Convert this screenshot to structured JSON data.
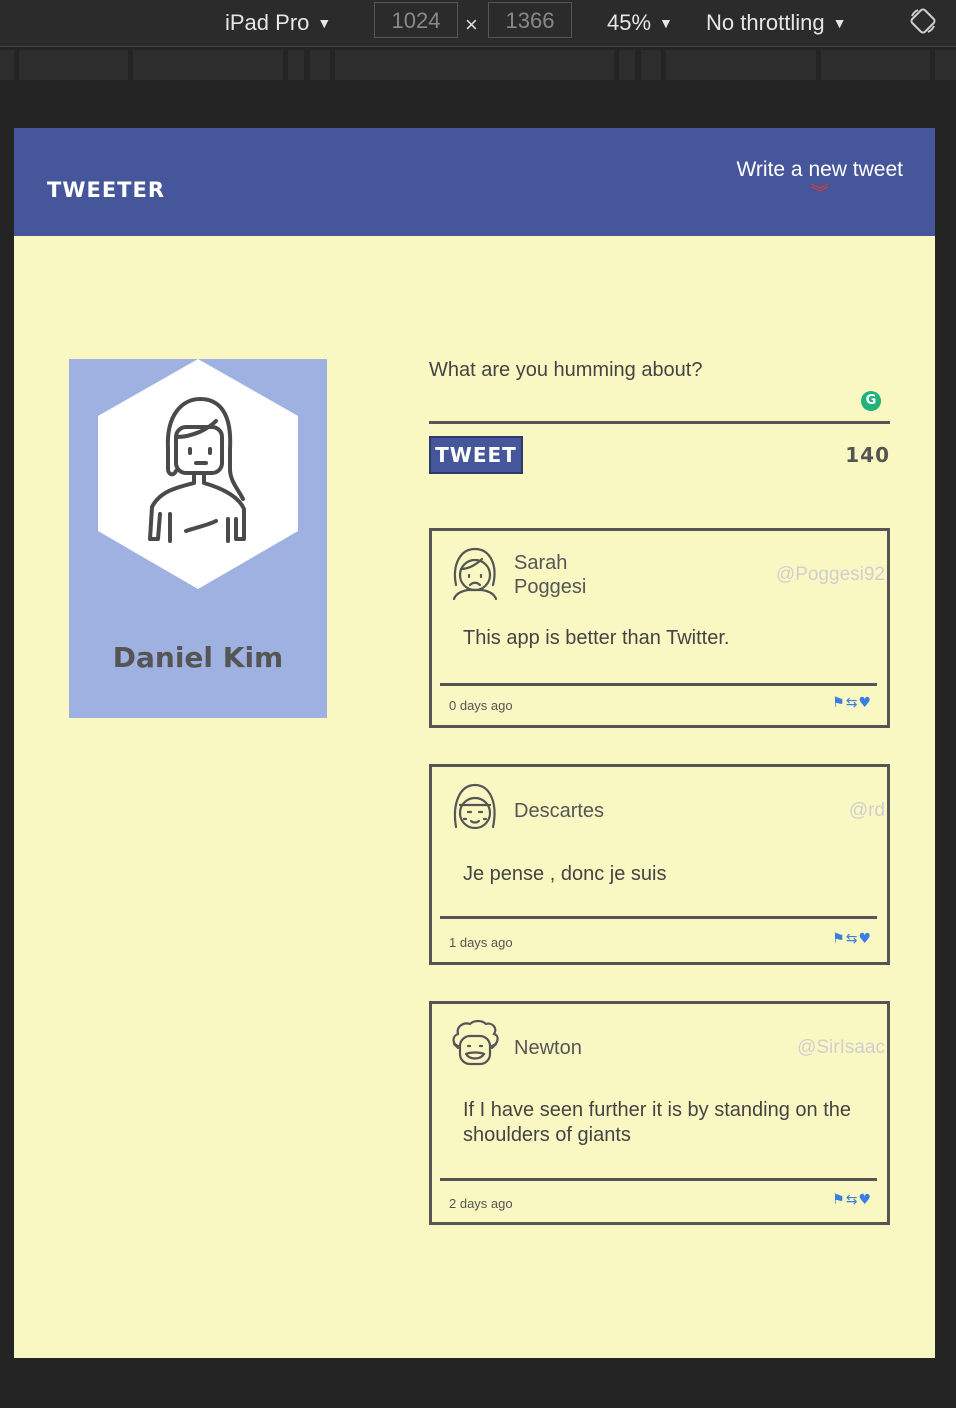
{
  "devtools": {
    "device": "iPad Pro",
    "width": "1024",
    "height": "1366",
    "times": "×",
    "zoom": "45%",
    "throttling": "No throttling"
  },
  "nav": {
    "brand": "TWEETER",
    "compose_label": "Write a new tweet",
    "compose_icon": "»"
  },
  "profile": {
    "name": "Daniel Kim"
  },
  "compose": {
    "placeholder": "What are you humming about?",
    "button_label": "TWEET",
    "counter": "140"
  },
  "tweets": [
    {
      "name": "Sarah\nPoggesi",
      "handle": "@Poggesi92",
      "content": "This app is better than Twitter.",
      "time": "0 days ago"
    },
    {
      "name": "Descartes",
      "handle": "@rd",
      "content": "Je pense , donc je suis",
      "time": "1 days ago"
    },
    {
      "name": "Newton",
      "handle": "@SirIsaac",
      "content": "If I have seen further it is by standing on the shoulders of giants",
      "time": "2 days ago"
    }
  ],
  "actions": {
    "flag": "⚑",
    "retweet": "⇆",
    "like": "♥"
  },
  "colors": {
    "nav_bg": "#46569a",
    "page_bg": "#faf8c2",
    "profile_bg": "#9eb1e0",
    "accent_red": "#e23a2a",
    "action_blue": "#3a7fe0"
  }
}
